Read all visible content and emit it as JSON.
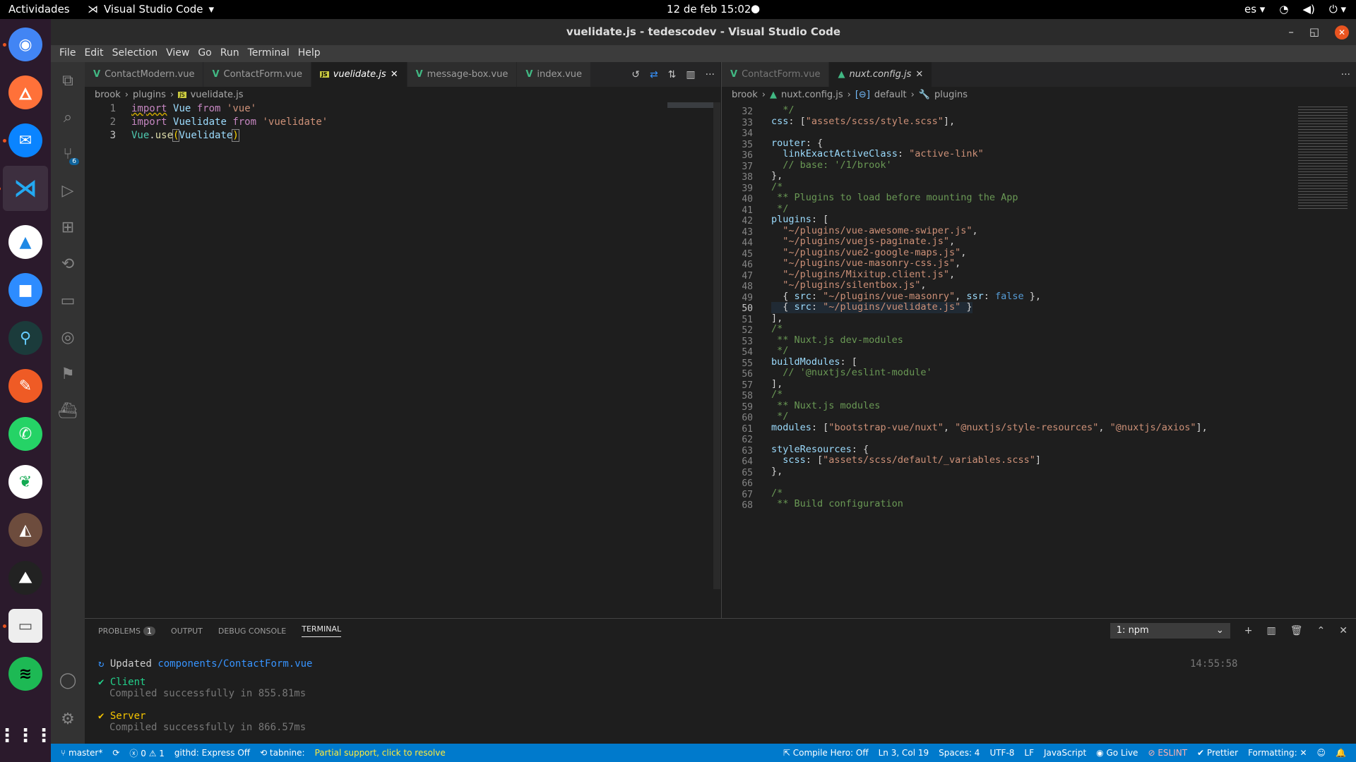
{
  "topbar": {
    "activities": "Actividades",
    "app": "Visual Studio Code",
    "clock": "12 de feb  15:02",
    "lang": "es"
  },
  "dock": [
    "chrome-icon",
    "firefox-icon",
    "thunderbird-icon",
    "vscode-icon",
    "draw-icon",
    "zoom-icon",
    "gitkraken-icon",
    "postman-icon",
    "whatsapp-icon",
    "mongodb-icon",
    "dbeaver-icon",
    "inkscape-icon",
    "files-icon",
    "spotify-icon",
    "apps-grid-icon"
  ],
  "window": {
    "title": "vuelidate.js - tedescodev - Visual Studio Code"
  },
  "menu": [
    "File",
    "Edit",
    "Selection",
    "View",
    "Go",
    "Run",
    "Terminal",
    "Help"
  ],
  "left": {
    "tabs": [
      {
        "label": "ContactModern.vue",
        "type": "vue"
      },
      {
        "label": "ContactForm.vue",
        "type": "vue"
      },
      {
        "label": "vuelidate.js",
        "type": "js",
        "active": true
      },
      {
        "label": "message-box.vue",
        "type": "vue"
      },
      {
        "label": "index.vue",
        "type": "vue"
      }
    ],
    "breadcrumb": [
      "brook",
      "plugins",
      "vuelidate.js"
    ],
    "lines": [
      {
        "n": "1",
        "t": "import Vue from 'vue'"
      },
      {
        "n": "2",
        "t": "import Vuelidate from 'vuelidate'"
      },
      {
        "n": "3",
        "t": "Vue.use(Vuelidate)"
      }
    ]
  },
  "right": {
    "tabs": [
      {
        "label": "ContactForm.vue",
        "type": "vue"
      },
      {
        "label": "nuxt.config.js",
        "type": "nuxt",
        "active": true
      }
    ],
    "breadcrumb": [
      "brook",
      "nuxt.config.js",
      "default",
      "plugins"
    ],
    "lines": [
      {
        "n": "32",
        "t": "  */"
      },
      {
        "n": "33",
        "t": "css: [\"assets/scss/style.scss\"],"
      },
      {
        "n": "34",
        "t": ""
      },
      {
        "n": "35",
        "t": "router: {"
      },
      {
        "n": "36",
        "t": "  linkExactActiveClass: \"active-link\""
      },
      {
        "n": "37",
        "t": "  // base: '/1/brook'"
      },
      {
        "n": "38",
        "t": "},"
      },
      {
        "n": "39",
        "t": "/*"
      },
      {
        "n": "40",
        "t": " ** Plugins to load before mounting the App"
      },
      {
        "n": "41",
        "t": " */"
      },
      {
        "n": "42",
        "t": "plugins: ["
      },
      {
        "n": "43",
        "t": "  \"~/plugins/vue-awesome-swiper.js\","
      },
      {
        "n": "44",
        "t": "  \"~/plugins/vuejs-paginate.js\","
      },
      {
        "n": "45",
        "t": "  \"~/plugins/vue2-google-maps.js\","
      },
      {
        "n": "46",
        "t": "  \"~/plugins/vue-masonry-css.js\","
      },
      {
        "n": "47",
        "t": "  \"~/plugins/Mixitup.client.js\","
      },
      {
        "n": "48",
        "t": "  \"~/plugins/silentbox.js\","
      },
      {
        "n": "49",
        "t": "  { src: \"~/plugins/vue-masonry\", ssr: false },"
      },
      {
        "n": "50",
        "t": "  { src: \"~/plugins/vuelidate.js\" }"
      },
      {
        "n": "51",
        "t": "],"
      },
      {
        "n": "52",
        "t": "/*"
      },
      {
        "n": "53",
        "t": " ** Nuxt.js dev-modules"
      },
      {
        "n": "54",
        "t": " */"
      },
      {
        "n": "55",
        "t": "buildModules: ["
      },
      {
        "n": "56",
        "t": "  // '@nuxtjs/eslint-module'"
      },
      {
        "n": "57",
        "t": "],"
      },
      {
        "n": "58",
        "t": "/*"
      },
      {
        "n": "59",
        "t": " ** Nuxt.js modules"
      },
      {
        "n": "60",
        "t": " */"
      },
      {
        "n": "61",
        "t": "modules: [\"bootstrap-vue/nuxt\", \"@nuxtjs/style-resources\", \"@nuxtjs/axios\"],"
      },
      {
        "n": "62",
        "t": ""
      },
      {
        "n": "63",
        "t": "styleResources: {"
      },
      {
        "n": "64",
        "t": "  scss: [\"assets/scss/default/_variables.scss\"]"
      },
      {
        "n": "65",
        "t": "},"
      },
      {
        "n": "66",
        "t": ""
      },
      {
        "n": "67",
        "t": "/*"
      },
      {
        "n": "68",
        "t": " ** Build configuration"
      }
    ]
  },
  "panel": {
    "tabs": [
      "PROBLEMS",
      "OUTPUT",
      "DEBUG CONSOLE",
      "TERMINAL"
    ],
    "problems_count": "1",
    "terminal_select": "1: npm",
    "updated_label": "Updated",
    "updated_file": "components/ContactForm.vue",
    "time": "14:55:58",
    "client": "Client",
    "client_msg": "Compiled successfully in 855.81ms",
    "server": "Server",
    "server_msg": "Compiled successfully in 866.57ms"
  },
  "status": {
    "branch": "master*",
    "errors": "0",
    "warnings": "1",
    "githd": "githd: Express Off",
    "tabnine": "tabnine:",
    "partial": "Partial support, click to resolve",
    "compile": "Compile Hero: Off",
    "pos": "Ln 3, Col 19",
    "spaces": "Spaces: 4",
    "enc": "UTF-8",
    "eol": "LF",
    "lang": "JavaScript",
    "golive": "Go Live",
    "eslint": "ESLINT",
    "prettier": "Prettier",
    "formatting": "Formatting: ✕"
  }
}
